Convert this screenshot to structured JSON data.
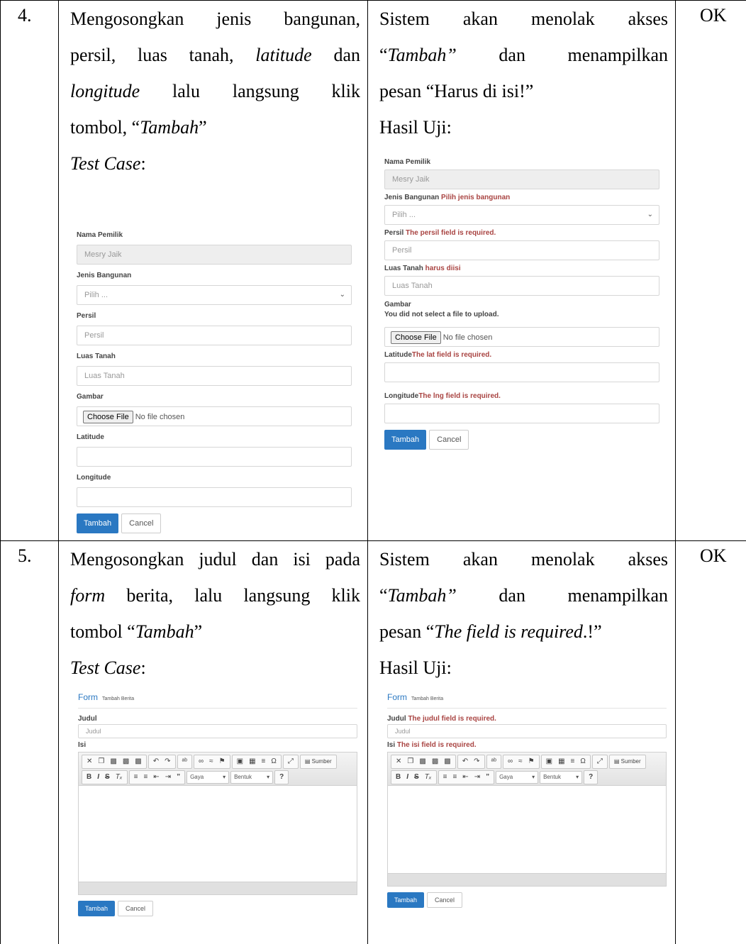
{
  "rows": [
    {
      "number": "4.",
      "status": "OK",
      "scenario": {
        "line1": "Mengosongkan jenis bangunan,",
        "line2a": "persil, luas tanah, ",
        "line2b": "latitude",
        "line2c": " dan",
        "line3a": "longitude",
        "line3b": " lalu langsung klik",
        "line4a": "tombol, “",
        "line4b": "Tambah",
        "line4c": "”",
        "test_case": "Test Case",
        "test_case_colon": ":"
      },
      "expected": {
        "line1": "Sistem akan menolak akses",
        "line2a": "“",
        "line2b": "Tambah”",
        "line2c": " dan menampilkan",
        "line3": "pesan “Harus di isi!”",
        "result": "Hasil Uji:"
      },
      "form_left": {
        "owner_label": "Nama Pemilik",
        "owner_value": "Mesry Jaik",
        "type_label": "Jenis Bangunan",
        "type_value": "Pilih ...",
        "persil_label": "Persil",
        "persil_placeholder": "Persil",
        "area_label": "Luas Tanah",
        "area_placeholder": "Luas Tanah",
        "image_label": "Gambar",
        "file_button": "Choose File",
        "file_status": "No file chosen",
        "lat_label": "Latitude",
        "lng_label": "Longitude",
        "submit": "Tambah",
        "cancel": "Cancel"
      },
      "form_right": {
        "owner_label": "Nama Pemilik",
        "owner_value": "Mesry Jaik",
        "type_label": "Jenis Bangunan",
        "type_error": "Pilih jenis bangunan",
        "type_value": "Pilih ...",
        "persil_label": "Persil",
        "persil_error": "The persil field is required.",
        "persil_placeholder": "Persil",
        "area_label": "Luas Tanah",
        "area_error": "harus diisi",
        "area_placeholder": "Luas Tanah",
        "image_label": "Gambar",
        "image_error": "You did not select a file to upload.",
        "file_button": "Choose File",
        "file_status": "No file chosen",
        "lat_label": "Latitude",
        "lat_error": "The lat field is required.",
        "lng_label": "Longitude",
        "lng_error": "The lng field is required.",
        "submit": "Tambah",
        "cancel": "Cancel"
      }
    },
    {
      "number": "5.",
      "status": "OK",
      "scenario": {
        "line1": "Mengosongkan judul dan isi pada",
        "line2a": "form",
        "line2b": " berita, lalu langsung klik",
        "line3a": "tombol “",
        "line3b": "Tambah",
        "line3c": "”",
        "test_case": "Test Case",
        "test_case_colon": ":"
      },
      "expected": {
        "line1": "Sistem akan menolak akses",
        "line2a": "“",
        "line2b": "Tambah”",
        "line2c": " dan menampilkan",
        "line3a": "pesan “",
        "line3b": "The field is required",
        "line3c": ".!”",
        "result": "Hasil Uji:"
      },
      "news_left": {
        "form_title": "Form",
        "form_subtitle": "Tambah Berita",
        "title_label": "Judul",
        "title_placeholder": "Judul",
        "content_label": "Isi",
        "source_button": "Sumber",
        "style_dropdown": "Gaya",
        "format_dropdown": "Bentuk",
        "submit": "Tambah",
        "cancel": "Cancel"
      },
      "news_right": {
        "form_title": "Form",
        "form_subtitle": "Tambah Berita",
        "title_label": "Judul",
        "title_error": "The judul field is required.",
        "title_placeholder": "Judul",
        "content_label": "Isi",
        "content_error": "The isi field is required.",
        "source_button": "Sumber",
        "style_dropdown": "Gaya",
        "format_dropdown": "Bentuk",
        "submit": "Tambah",
        "cancel": "Cancel"
      }
    }
  ]
}
